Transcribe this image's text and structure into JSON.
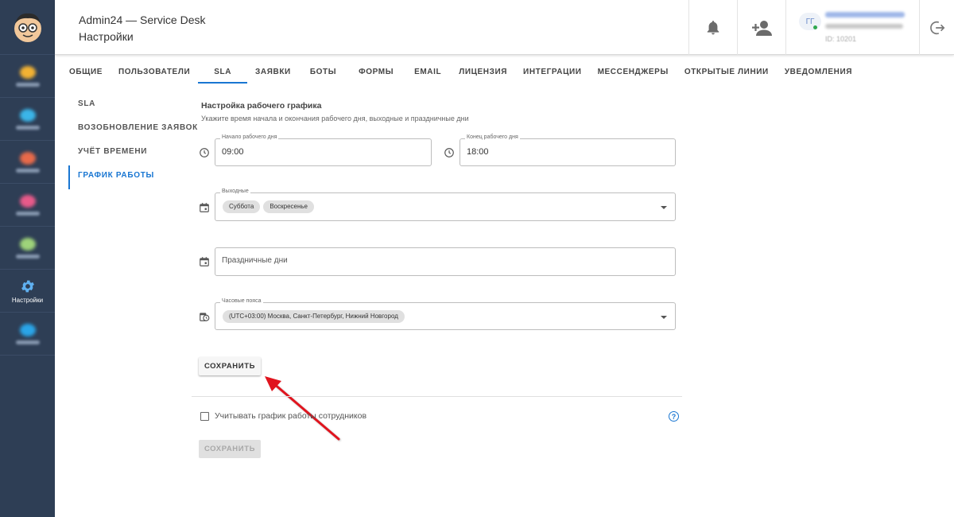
{
  "header": {
    "app_title": "Admin24 — Service Desk",
    "page_title": "Настройки",
    "user_avatar_initials": "ГГ",
    "user_id": "ID: 10201"
  },
  "leftnav": {
    "active_label": "Настройки",
    "accent_color": "#2e3e55"
  },
  "tabs": [
    {
      "label": "ОБЩИЕ"
    },
    {
      "label": "ПОЛЬЗОВАТЕЛИ"
    },
    {
      "label": "SLA"
    },
    {
      "label": "ЗАЯВКИ"
    },
    {
      "label": "БОТЫ"
    },
    {
      "label": "ФОРМЫ"
    },
    {
      "label": "EMAIL"
    },
    {
      "label": "ЛИЦЕНЗИЯ"
    },
    {
      "label": "ИНТЕГРАЦИИ"
    },
    {
      "label": "МЕССЕНДЖЕРЫ"
    },
    {
      "label": "ОТКРЫТЫЕ ЛИНИИ"
    },
    {
      "label": "УВЕДОМЛЕНИЯ"
    }
  ],
  "subnav": [
    {
      "label": "SLA"
    },
    {
      "label": "ВОЗОБНОВЛЕНИЕ ЗАЯВОК"
    },
    {
      "label": "УЧЁТ ВРЕМЕНИ"
    },
    {
      "label": "ГРАФИК РАБОТЫ"
    }
  ],
  "schedule": {
    "title": "Настройка рабочего графика",
    "description": "Укажите время начала и окончания рабочего дня, выходные и праздничные дни",
    "start_label": "Начало рабочего дня",
    "start_value": "09:00",
    "end_label": "Конец рабочего дня",
    "end_value": "18:00",
    "weekends_label": "Выходные",
    "weekends": [
      "Суббота",
      "Воскресенье"
    ],
    "holidays_placeholder": "Праздничные дни",
    "timezone_label": "Часовые пояса",
    "timezone_value": "(UTC+03:00) Москва, Санкт-Петербург, Нижний Новгород",
    "save_label": "СОХРАНИТЬ"
  },
  "employees": {
    "checkbox_label": "Учитывать график работы сотрудников",
    "checked": false,
    "help_label": "?",
    "save_label": "СОХРАНИТЬ"
  },
  "colors": {
    "accent": "#1976d2",
    "annotation_arrow": "#e0141e"
  }
}
